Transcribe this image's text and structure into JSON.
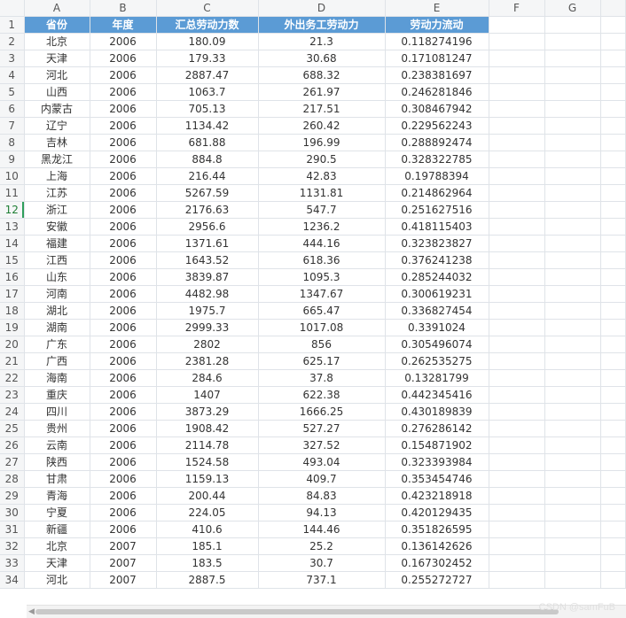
{
  "columns": [
    "A",
    "B",
    "C",
    "D",
    "E",
    "F",
    "G"
  ],
  "headers": [
    "省份",
    "年度",
    "汇总劳动力数",
    "外出务工劳动力",
    "劳动力流动"
  ],
  "rows": [
    [
      "北京",
      "2006",
      "180.09",
      "21.3",
      "0.118274196"
    ],
    [
      "天津",
      "2006",
      "179.33",
      "30.68",
      "0.171081247"
    ],
    [
      "河北",
      "2006",
      "2887.47",
      "688.32",
      "0.238381697"
    ],
    [
      "山西",
      "2006",
      "1063.7",
      "261.97",
      "0.246281846"
    ],
    [
      "内蒙古",
      "2006",
      "705.13",
      "217.51",
      "0.308467942"
    ],
    [
      "辽宁",
      "2006",
      "1134.42",
      "260.42",
      "0.229562243"
    ],
    [
      "吉林",
      "2006",
      "681.88",
      "196.99",
      "0.288892474"
    ],
    [
      "黑龙江",
      "2006",
      "884.8",
      "290.5",
      "0.328322785"
    ],
    [
      "上海",
      "2006",
      "216.44",
      "42.83",
      "0.19788394"
    ],
    [
      "江苏",
      "2006",
      "5267.59",
      "1131.81",
      "0.214862964"
    ],
    [
      "浙江",
      "2006",
      "2176.63",
      "547.7",
      "0.251627516"
    ],
    [
      "安徽",
      "2006",
      "2956.6",
      "1236.2",
      "0.418115403"
    ],
    [
      "福建",
      "2006",
      "1371.61",
      "444.16",
      "0.323823827"
    ],
    [
      "江西",
      "2006",
      "1643.52",
      "618.36",
      "0.376241238"
    ],
    [
      "山东",
      "2006",
      "3839.87",
      "1095.3",
      "0.285244032"
    ],
    [
      "河南",
      "2006",
      "4482.98",
      "1347.67",
      "0.300619231"
    ],
    [
      "湖北",
      "2006",
      "1975.7",
      "665.47",
      "0.336827454"
    ],
    [
      "湖南",
      "2006",
      "2999.33",
      "1017.08",
      "0.3391024"
    ],
    [
      "广东",
      "2006",
      "2802",
      "856",
      "0.305496074"
    ],
    [
      "广西",
      "2006",
      "2381.28",
      "625.17",
      "0.262535275"
    ],
    [
      "海南",
      "2006",
      "284.6",
      "37.8",
      "0.13281799"
    ],
    [
      "重庆",
      "2006",
      "1407",
      "622.38",
      "0.442345416"
    ],
    [
      "四川",
      "2006",
      "3873.29",
      "1666.25",
      "0.430189839"
    ],
    [
      "贵州",
      "2006",
      "1908.42",
      "527.27",
      "0.276286142"
    ],
    [
      "云南",
      "2006",
      "2114.78",
      "327.52",
      "0.154871902"
    ],
    [
      "陕西",
      "2006",
      "1524.58",
      "493.04",
      "0.323393984"
    ],
    [
      "甘肃",
      "2006",
      "1159.13",
      "409.7",
      "0.353454746"
    ],
    [
      "青海",
      "2006",
      "200.44",
      "84.83",
      "0.423218918"
    ],
    [
      "宁夏",
      "2006",
      "224.05",
      "94.13",
      "0.420129435"
    ],
    [
      "新疆",
      "2006",
      "410.6",
      "144.46",
      "0.351826595"
    ],
    [
      "北京",
      "2007",
      "185.1",
      "25.2",
      "0.136142626"
    ],
    [
      "天津",
      "2007",
      "183.5",
      "30.7",
      "0.167302452"
    ],
    [
      "河北",
      "2007",
      "2887.5",
      "737.1",
      "0.255272727"
    ]
  ],
  "active_row": 12,
  "watermark": "CSDN @samFuB",
  "colors": {
    "header_fill": "#5b9bd5",
    "header_text": "#ffffff",
    "active_row_marker": "#2e9e5b"
  }
}
